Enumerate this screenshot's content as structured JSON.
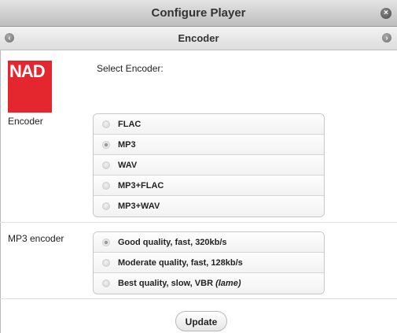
{
  "window": {
    "title": "Configure Player",
    "close_icon": "close-icon"
  },
  "page": {
    "title": "Encoder",
    "back_icon": "back-icon",
    "forward_icon": "forward-icon"
  },
  "brand": {
    "logo_text": "NAD",
    "logo_color": "#e4262f"
  },
  "intro": {
    "label": "Select Encoder:"
  },
  "encoder": {
    "label": "Encoder",
    "selected": "MP3",
    "options": [
      "FLAC",
      "MP3",
      "WAV",
      "MP3+FLAC",
      "MP3+WAV"
    ]
  },
  "mp3_encoder": {
    "label": "MP3 encoder",
    "selected": "Good quality, fast, 320kb/s",
    "options": [
      {
        "text": "Good quality, fast, 320kb/s",
        "suffix": ""
      },
      {
        "text": "Moderate quality, fast, 128kb/s",
        "suffix": ""
      },
      {
        "text": "Best quality, slow, VBR ",
        "suffix": "(lame)"
      }
    ]
  },
  "actions": {
    "update_label": "Update"
  }
}
